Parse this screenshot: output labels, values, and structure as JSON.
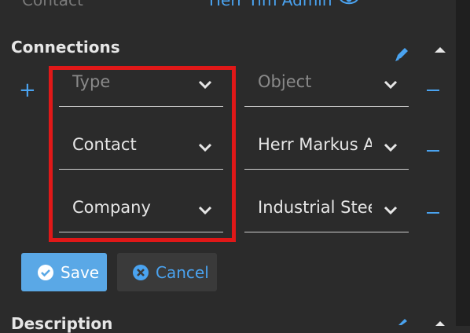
{
  "header_partial": {
    "contact_label": "Contact",
    "contact_value": "Herr Tim Admin"
  },
  "connections": {
    "title": "Connections",
    "rows": [
      {
        "type": "Type",
        "object": "Object",
        "type_is_placeholder": true,
        "object_is_placeholder": true
      },
      {
        "type": "Contact",
        "object": "Herr Markus A"
      },
      {
        "type": "Company",
        "object": "Industrial Stee"
      }
    ],
    "icons": {
      "edit": "pencil-icon",
      "collapse": "chevron-up-icon",
      "add": "plus-icon",
      "remove": "minus-icon",
      "dropdown": "chevron-down-icon",
      "visibility": "eye-icon"
    }
  },
  "actions": {
    "save_label": "Save",
    "cancel_label": "Cancel"
  },
  "next_section": {
    "title": "Description"
  },
  "colors": {
    "background": "#2b2b2b",
    "accent": "#4aa3f0",
    "save_button": "#5aa8e6",
    "highlight": "#e01818"
  }
}
